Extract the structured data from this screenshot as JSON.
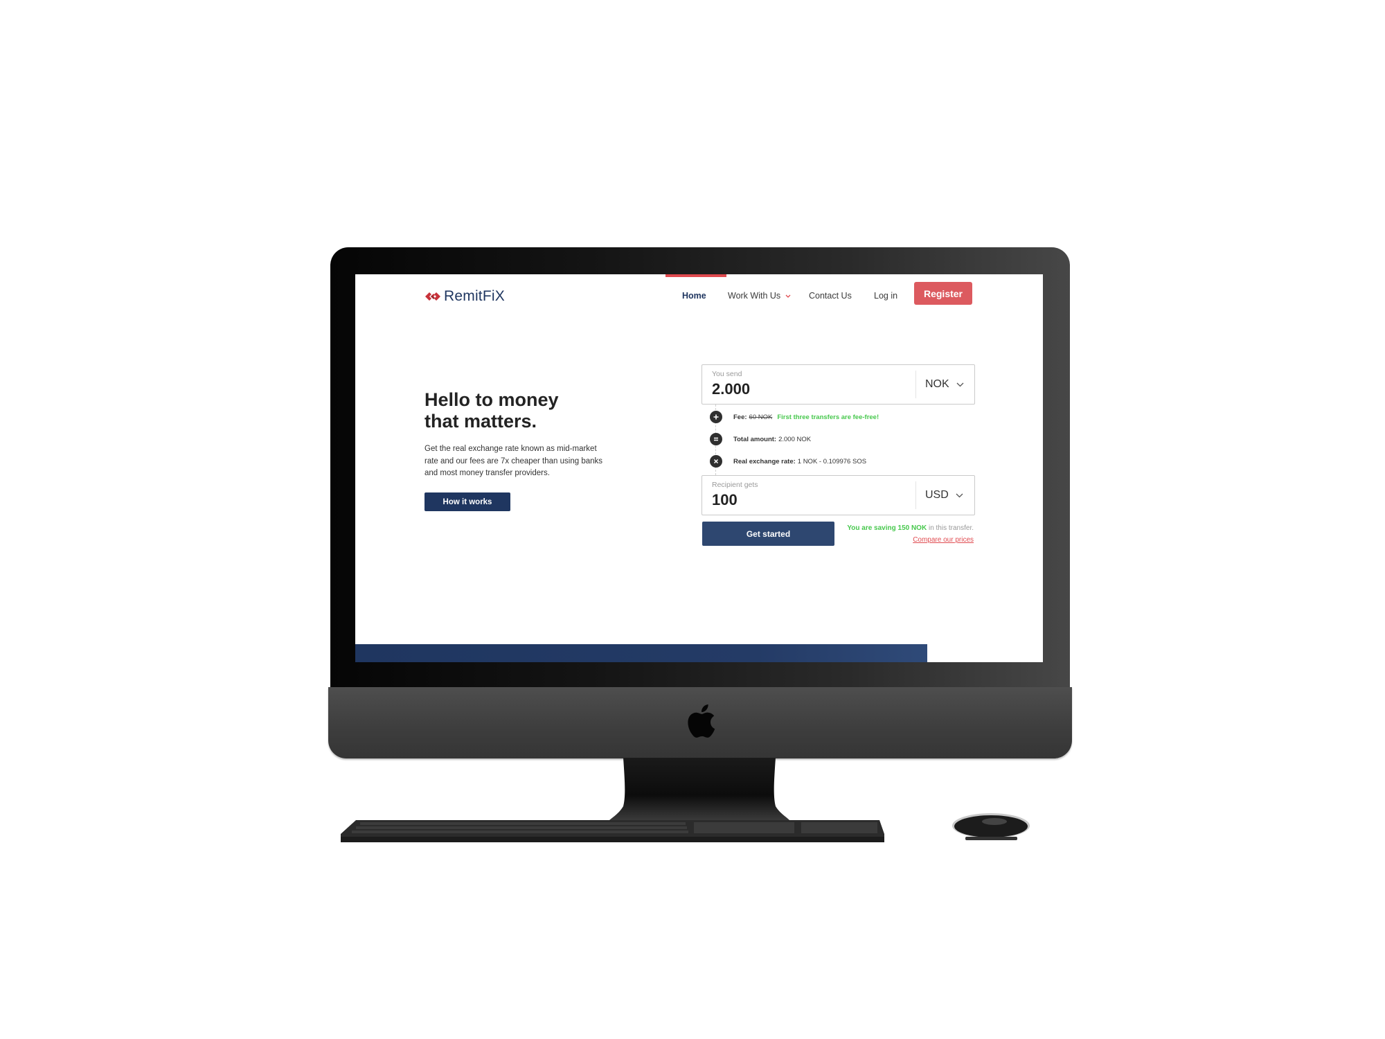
{
  "site": {
    "brand": "RemitFiX",
    "colors": {
      "navy": "#1f3660",
      "accent_red": "#dc5a5f",
      "success_green": "#47c84d"
    }
  },
  "nav": {
    "items": [
      {
        "label": "Home",
        "active": true
      },
      {
        "label": "Work With Us",
        "has_dropdown": true
      },
      {
        "label": "Contact Us"
      },
      {
        "label": "Log in"
      }
    ],
    "register_label": "Register"
  },
  "hero": {
    "title_line1": "Hello to money",
    "title_line2": "that matters.",
    "description": "Get the real exchange rate known as mid-market rate and our fees are 7x cheaper than using banks and most money transfer providers.",
    "cta_label": "How it works"
  },
  "converter": {
    "send": {
      "label": "You send",
      "value": "2.000",
      "currency": "NOK"
    },
    "fee": {
      "label": "Fee:",
      "original": "60 NOK",
      "promo": "First three transfers are fee-free!",
      "icon": "plus-icon"
    },
    "total": {
      "label": "Total amount:",
      "value": "2.000 NOK",
      "icon": "equals-icon"
    },
    "rate": {
      "label": "Real exchange rate:",
      "value": "1 NOK - 0.109976 SOS",
      "icon": "times-icon"
    },
    "receive": {
      "label": "Recipient gets",
      "value": "100",
      "currency": "USD"
    },
    "cta_label": "Get started",
    "saving_prefix": "You are saving 150 NOK",
    "saving_suffix": " in this transfer.",
    "compare_link": "Compare our prices"
  }
}
